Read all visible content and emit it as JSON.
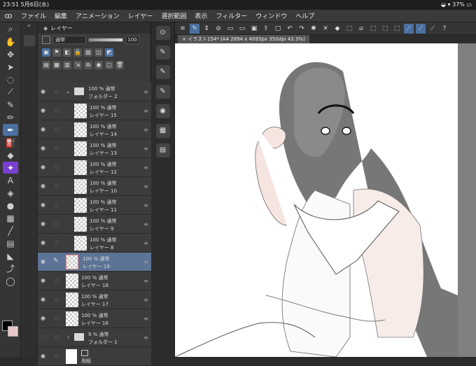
{
  "status": {
    "time": "23:51",
    "date": "5月6日(水)",
    "battery": "37%"
  },
  "menu": [
    "ファイル",
    "編集",
    "アニメーション",
    "レイヤー",
    "選択範囲",
    "表示",
    "フィルター",
    "ウィンドウ",
    "ヘルプ"
  ],
  "layer_panel": {
    "title": "レイヤー",
    "blend_mode": "通常",
    "opacity": "100",
    "layers": [
      {
        "kind": "folder",
        "line1": "100 % 通常",
        "line2": "フォルダー 2"
      },
      {
        "kind": "layer",
        "line1": "100 % 通常",
        "line2": "レイヤー 15"
      },
      {
        "kind": "layer",
        "line1": "100 % 通常",
        "line2": "レイヤー 14"
      },
      {
        "kind": "layer",
        "line1": "100 % 通常",
        "line2": "レイヤー 13"
      },
      {
        "kind": "layer",
        "line1": "100 % 通常",
        "line2": "レイヤー 12"
      },
      {
        "kind": "layer",
        "line1": "100 % 通常",
        "line2": "レイヤー 10"
      },
      {
        "kind": "layer",
        "line1": "100 % 通常",
        "line2": "レイヤー 11"
      },
      {
        "kind": "layer",
        "line1": "100 % 通常",
        "line2": "レイヤー 9"
      },
      {
        "kind": "layer",
        "line1": "100 % 通常",
        "line2": "レイヤー 8"
      },
      {
        "kind": "layer-selected",
        "line1": "100 % 通常",
        "line2": "レイヤー 19"
      },
      {
        "kind": "layer",
        "line1": "100 % 通常",
        "line2": "レイヤー 18"
      },
      {
        "kind": "layer",
        "line1": "100 % 通常",
        "line2": "レイヤー 17"
      },
      {
        "kind": "layer",
        "line1": "100 % 通常",
        "line2": "レイヤー 16"
      },
      {
        "kind": "folder-collapsed",
        "line1": "9 % 通常",
        "line2": "フォルダー 1"
      },
      {
        "kind": "paper",
        "line1": "",
        "line2": "用紙"
      }
    ]
  },
  "canvas_tab": "イラスト154* (A4 2894 x 4093px 350dpi 43.3%)",
  "colors": {
    "accent": "#4a6fa0",
    "selected_layer": "#5d7396",
    "ui_dark": "#2b2b2b"
  }
}
